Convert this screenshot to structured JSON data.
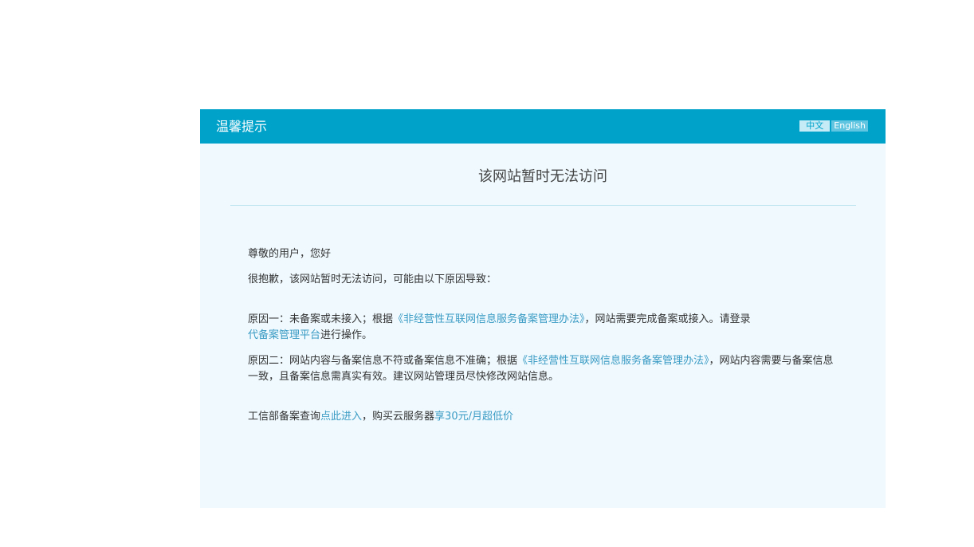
{
  "header": {
    "title": "温馨提示",
    "lang_cn": "中文",
    "lang_en": "English"
  },
  "main": {
    "title": "该网站暂时无法访问",
    "greeting": "尊敬的用户，您好",
    "apology": "很抱歉，该网站暂时无法访问，可能由以下原因导致：",
    "reason1": {
      "prefix": "原因一：未备案或未接入；根据",
      "link1": "《非经营性互联网信息服务备案管理办法》",
      "middle": "，网站需要完成备案或接入。请登录",
      "link2": "代备案管理平台",
      "suffix": "进行操作。"
    },
    "reason2": {
      "prefix": "原因二：网站内容与备案信息不符或备案信息不准确；根据",
      "link": "《非经营性互联网信息服务备案管理办法》",
      "suffix": "，网站内容需要与备案信息一致，且备案信息需真实有效。建议网站管理员尽快修改网站信息。"
    },
    "footer": {
      "prefix": "工信部备案查询",
      "link1": "点此进入",
      "middle": "，购买云服务器",
      "link2": "享30元/月超低价"
    }
  },
  "colors": {
    "header_bg": "#00a2ca",
    "panel_bg": "#eff9fe",
    "link": "#3a9bc4"
  }
}
